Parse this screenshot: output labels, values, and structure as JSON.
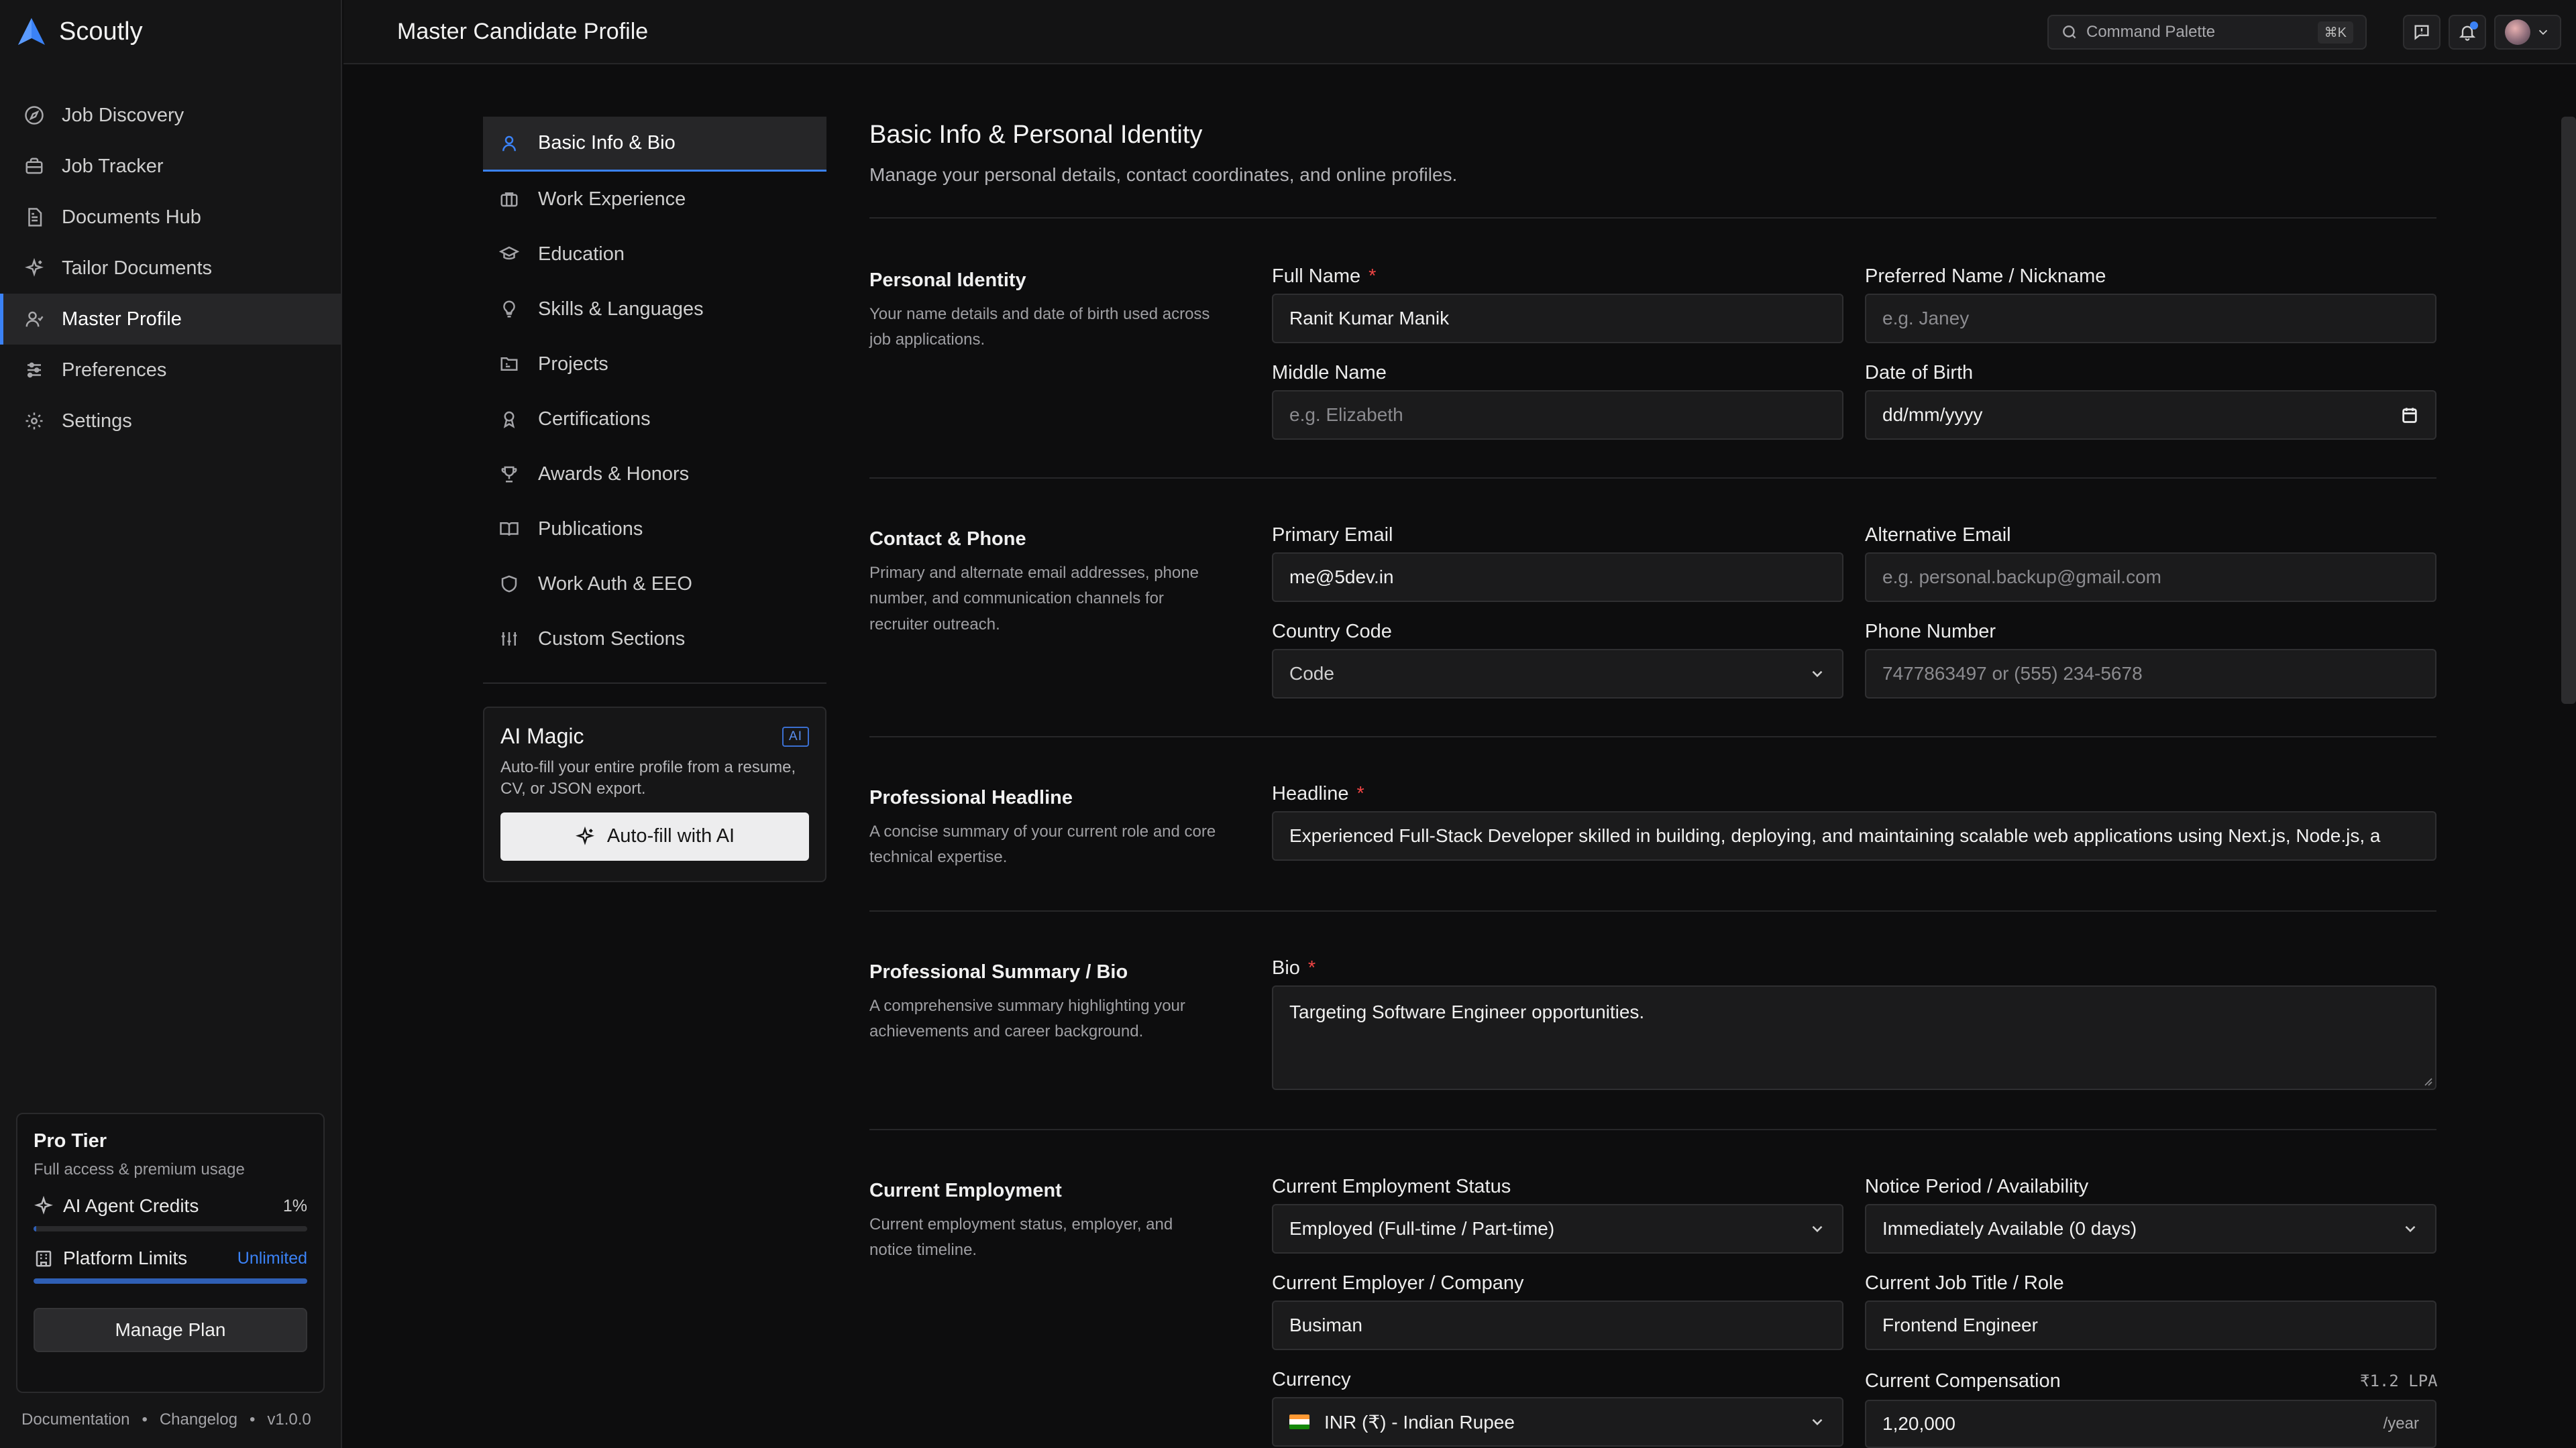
{
  "app": {
    "name": "Scoutly",
    "page_title": "Master Candidate Profile"
  },
  "sidebar": {
    "items": [
      {
        "label": "Job Discovery",
        "icon": "compass-icon"
      },
      {
        "label": "Job Tracker",
        "icon": "briefcase-icon"
      },
      {
        "label": "Documents Hub",
        "icon": "document-icon"
      },
      {
        "label": "Tailor Documents",
        "icon": "sparkles-icon"
      },
      {
        "label": "Master Profile",
        "icon": "user-icon",
        "active": true
      },
      {
        "label": "Preferences",
        "icon": "sliders-icon"
      },
      {
        "label": "Settings",
        "icon": "gear-icon"
      }
    ],
    "tier": {
      "title": "Pro Tier",
      "subtitle": "Full access & premium usage",
      "credits_label": "AI Agent Credits",
      "credits_pct": "1%",
      "credits_fraction": 0.01,
      "limits_label": "Platform Limits",
      "limits_value": "Unlimited",
      "limits_fraction": 1.0,
      "manage_label": "Manage Plan"
    },
    "footer": {
      "docs": "Documentation",
      "changelog": "Changelog",
      "version": "v1.0.0",
      "sep": "•"
    }
  },
  "header": {
    "command_palette": "Command Palette",
    "shortcut": "⌘K"
  },
  "subnav": {
    "items": [
      {
        "label": "Basic Info & Bio",
        "icon": "user-icon",
        "active": true
      },
      {
        "label": "Work Experience",
        "icon": "briefcase-icon"
      },
      {
        "label": "Education",
        "icon": "graduation-cap-icon"
      },
      {
        "label": "Skills & Languages",
        "icon": "lightbulb-icon"
      },
      {
        "label": "Projects",
        "icon": "folder-icon"
      },
      {
        "label": "Certifications",
        "icon": "award-icon"
      },
      {
        "label": "Awards & Honors",
        "icon": "trophy-icon"
      },
      {
        "label": "Publications",
        "icon": "book-icon"
      },
      {
        "label": "Work Auth & EEO",
        "icon": "shield-icon"
      },
      {
        "label": "Custom Sections",
        "icon": "sliders-icon"
      }
    ],
    "ai_magic": {
      "title": "AI Magic",
      "badge": "AI",
      "description": "Auto-fill your entire profile from a resume, CV, or JSON export.",
      "button": "Auto-fill with AI"
    }
  },
  "main": {
    "title": "Basic Info & Personal Identity",
    "subtitle": "Manage your personal details, contact coordinates, and online profiles.",
    "identity": {
      "title": "Personal Identity",
      "desc": "Your name details and date of birth used across job applications.",
      "full_name_label": "Full Name",
      "full_name_value": "Ranit Kumar Manik",
      "nickname_label": "Preferred Name / Nickname",
      "nickname_placeholder": "e.g. Janey",
      "middle_label": "Middle Name",
      "middle_placeholder": "e.g. Elizabeth",
      "dob_label": "Date of Birth",
      "dob_value": "dd/mm/yyyy"
    },
    "contact": {
      "title": "Contact & Phone",
      "desc": "Primary and alternate email addresses, phone number, and communication channels for recruiter outreach.",
      "primary_email_label": "Primary Email",
      "primary_email_value": "me@5dev.in",
      "alt_email_label": "Alternative Email",
      "alt_email_placeholder": "e.g. personal.backup@gmail.com",
      "country_code_label": "Country Code",
      "country_code_value": "Code",
      "phone_label": "Phone Number",
      "phone_placeholder": "7477863497 or (555) 234-5678"
    },
    "headline": {
      "title": "Professional Headline",
      "desc": "A concise summary of your current role and core technical expertise.",
      "label": "Headline",
      "value": "Experienced Full-Stack Developer skilled in building, deploying, and maintaining scalable web applications using Next.js, Node.js, a"
    },
    "bio": {
      "title": "Professional Summary / Bio",
      "desc": "A comprehensive summary highlighting your achievements and career background.",
      "label": "Bio",
      "value": "Targeting Software Engineer opportunities."
    },
    "employment": {
      "title": "Current Employment",
      "desc": "Current employment status, employer, and notice timeline.",
      "status_label": "Current Employment Status",
      "status_value": "Employed (Full-time / Part-time)",
      "notice_label": "Notice Period / Availability",
      "notice_value": "Immediately Available (0 days)",
      "employer_label": "Current Employer / Company",
      "employer_value": "Busiman",
      "job_title_label": "Current Job Title / Role",
      "job_title_value": "Frontend Engineer",
      "currency_label": "Currency",
      "currency_value": "INR (₹) - Indian Rupee",
      "comp_label": "Current Compensation",
      "comp_hint": "₹1.2 LPA",
      "comp_value": "1,20,000",
      "comp_suffix": "/year"
    }
  },
  "colors": {
    "accent": "#3b82f6",
    "required": "#ef4444",
    "background": "#0d0d0e",
    "sidebar": "#151516"
  }
}
